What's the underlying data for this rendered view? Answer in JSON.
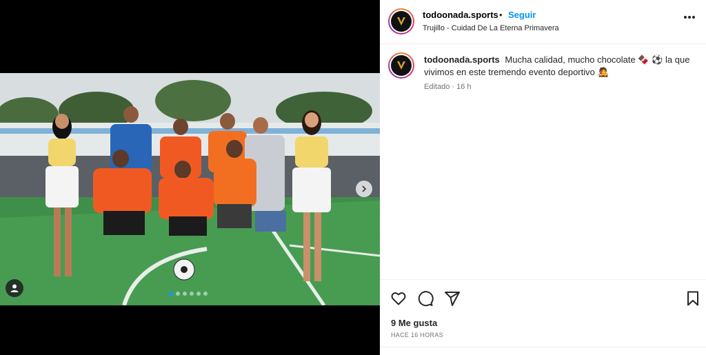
{
  "post": {
    "username": "todoonada.sports",
    "follow_label": "Seguir",
    "separator": "•",
    "location": "Trujillo - Cuidad De La Eterna Primavera",
    "more_icon": "more-horizontal-icon"
  },
  "caption": {
    "username": "todoonada.sports",
    "text_part1": "Mucha calidad, mucho chocolate",
    "emoji1": "🍫",
    "emoji2": "⚽",
    "text_part2": "la que vivimos en este tremendo evento deportivo",
    "emoji3": "🧑‍🎤",
    "edited_label": "Editado",
    "age": "16 h"
  },
  "engagement": {
    "likes_label": "9 Me gusta",
    "timestamp": "HACE 16 HORAS"
  },
  "carousel": {
    "total_slides": 6,
    "active_slide": 1
  },
  "colors": {
    "accent": "#0095f6",
    "carousel_active": "#1e90ff"
  }
}
